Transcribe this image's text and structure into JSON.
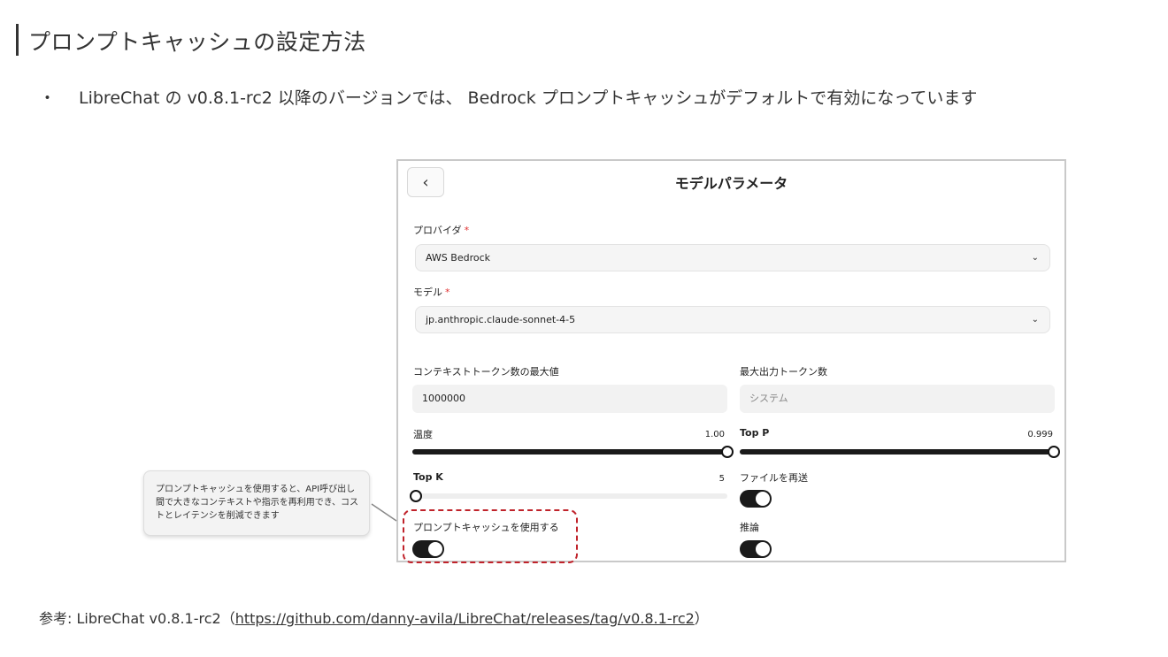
{
  "title": "プロンプトキャッシュの設定方法",
  "bullet": {
    "dot": "・",
    "text": "LibreChat の v0.8.1-rc2 以降のバージョンでは、 Bedrock プロンプトキャッシュがデフォルトで有効になっています"
  },
  "panel": {
    "back_icon": "‹",
    "title": "モデルパラメータ",
    "provider": {
      "label": "プロバイダ",
      "required": "*",
      "value": "AWS Bedrock",
      "chevron": "⌄"
    },
    "model": {
      "label": "モデル",
      "required": "*",
      "value": "jp.anthropic.claude-sonnet-4-5",
      "chevron": "⌄"
    },
    "context_tokens": {
      "label": "コンテキストトークン数の最大値",
      "value": "1000000"
    },
    "max_output_tokens": {
      "label": "最大出力トークン数",
      "placeholder": "システム"
    },
    "temperature": {
      "label": "温度",
      "value": "1.00",
      "level": 1.0
    },
    "top_p": {
      "label": "Top P",
      "value": "0.999",
      "level": 0.999
    },
    "top_k": {
      "label": "Top K",
      "value": "5",
      "level": 0.0
    },
    "resend_files": {
      "label": "ファイルを再送",
      "on": true
    },
    "prompt_cache": {
      "label": "プロンプトキャッシュを使用する",
      "on": true
    },
    "reasoning": {
      "label": "推論",
      "on": true
    }
  },
  "callout": {
    "text": "プロンプトキャッシュを使用すると、API呼び出し間で大きなコンテキストや指示を再利用でき、コストとレイテンシを削減できます"
  },
  "reference": {
    "prefix": "参考: LibreChat v0.8.1-rc2（",
    "link": "https://github.com/danny-avila/LibreChat/releases/tag/v0.8.1-rc2",
    "suffix": "）"
  },
  "colors": {
    "accent_dashed": "#c0232b",
    "required": "#e03030",
    "toggle_on": "#1a1a1a"
  }
}
